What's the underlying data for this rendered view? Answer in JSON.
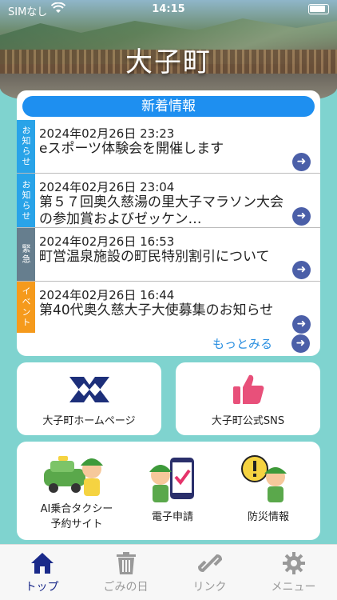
{
  "status_bar": {
    "carrier": "SIMなし",
    "time": "14:15"
  },
  "page_title": "大子町",
  "news": {
    "header": "新着情報",
    "items": [
      {
        "tag": "お知らせ",
        "tag_color": "#29a3e8",
        "date": "2024年02月26日 23:23",
        "text": "eスポーツ体験会を開催します"
      },
      {
        "tag": "お知らせ",
        "tag_color": "#29a3e8",
        "date": "2024年02月26日 23:04",
        "text": "第５７回奥久慈湯の里大子マラソン大会の参加賞およびゼッケン…"
      },
      {
        "tag": "緊急",
        "tag_color": "#667e8e",
        "date": "2024年02月26日 16:53",
        "text": "町営温泉施設の町民特別割引について"
      },
      {
        "tag": "イベント",
        "tag_color": "#f59a1c",
        "date": "2024年02月26日 16:44",
        "text": "第40代奥久慈大子大使募集のお知らせ"
      }
    ],
    "more_label": "もっとみる"
  },
  "tiles": {
    "homepage": "大子町ホームページ",
    "sns": "大子町公式SNS"
  },
  "services": [
    {
      "label_line1": "AI乗合タクシー",
      "label_line2": "予約サイト"
    },
    {
      "label_line1": "電子申請",
      "label_line2": ""
    },
    {
      "label_line1": "防災情報",
      "label_line2": ""
    }
  ],
  "tabs": [
    {
      "label": "トップ"
    },
    {
      "label": "ごみの日"
    },
    {
      "label": "リンク"
    },
    {
      "label": "メニュー"
    }
  ]
}
